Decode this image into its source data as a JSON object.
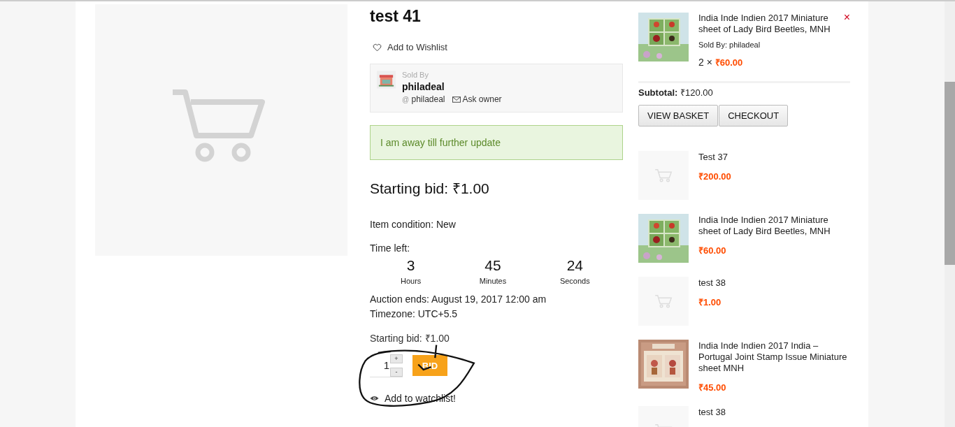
{
  "product": {
    "title": "test 41",
    "wishlist": "Add to Wishlist",
    "seller": {
      "heading": "Sold By",
      "name": "philadeal",
      "handle_prefix": "@",
      "handle": "philadeal",
      "ask": "Ask owner"
    },
    "notice": "I am away till further update",
    "starting_bid": "Starting bid: ₹1.00",
    "condition": "Item condition: New",
    "time_left_label": "Time left:",
    "countdown": [
      {
        "value": "3",
        "unit": "Hours"
      },
      {
        "value": "45",
        "unit": "Minutes"
      },
      {
        "value": "24",
        "unit": "Seconds"
      }
    ],
    "auction_ends": "Auction ends: August 19, 2017 12:00 am",
    "timezone": "Timezone: UTC+5.5",
    "bid_label": "Starting bid: ₹1.00",
    "quantity": "1",
    "plus": "+",
    "minus": "-",
    "bid_button": "BID",
    "watchlist": "Add to watchlist!"
  },
  "cart": {
    "item": {
      "title": "India Inde Indien 2017 Miniature sheet of Lady Bird Beetles, MNH",
      "remove": "×",
      "sold_by_label": "Sold By:",
      "sold_by": "philadeal",
      "quantity": "2 ×",
      "price": "₹60.00"
    },
    "subtotal_label": "Subtotal:",
    "subtotal": "₹120.00",
    "buttons": [
      "VIEW BASKET",
      "CHECKOUT"
    ]
  },
  "products": [
    {
      "kind": "placeholder",
      "title": "Test 37",
      "price": "₹200.00"
    },
    {
      "title": "India Inde Indien 2017 Miniature sheet of Lady Bird Beetles, MNH",
      "price": "₹60.00"
    },
    {
      "kind": "placeholder",
      "title": "test 38",
      "price": "₹1.00"
    },
    {
      "kind": "pattern",
      "title": "India Inde Indien 2017 India – Portugal Joint Stamp Issue Miniature sheet MNH",
      "price": "₹45.00"
    },
    {
      "kind": "placeholder",
      "title": "test 38"
    }
  ]
}
